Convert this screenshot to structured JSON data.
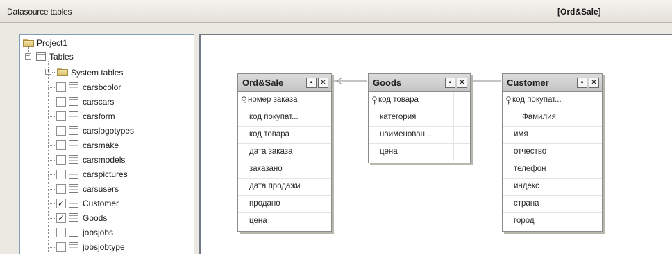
{
  "header": {
    "title": "Datasource tables",
    "context": "[Ord&Sale]"
  },
  "tree": {
    "root": "Project1",
    "tables_node": "Tables",
    "system_tables": "System tables",
    "items": [
      {
        "label": "carsbcolor",
        "checked": false
      },
      {
        "label": "carscars",
        "checked": false
      },
      {
        "label": "carsform",
        "checked": false
      },
      {
        "label": "carslogotypes",
        "checked": false
      },
      {
        "label": "carsmake",
        "checked": false
      },
      {
        "label": "carsmodels",
        "checked": false
      },
      {
        "label": "carspictures",
        "checked": false
      },
      {
        "label": "carsusers",
        "checked": false
      },
      {
        "label": "Customer",
        "checked": true
      },
      {
        "label": "Goods",
        "checked": true
      },
      {
        "label": "jobsjobs",
        "checked": false
      },
      {
        "label": "jobsjobtype",
        "checked": false
      }
    ]
  },
  "entities": {
    "ordsale": {
      "title": "Ord&Sale",
      "fields": [
        "номер заказа",
        "код покупат...",
        "код товара",
        "дата заказа",
        "заказано",
        "дата продажи",
        "продано",
        "цена"
      ]
    },
    "goods": {
      "title": "Goods",
      "fields": [
        "код товара",
        "категория",
        "наименован...",
        "цена"
      ]
    },
    "customer": {
      "title": "Customer",
      "fields": [
        "код покупат...",
        "Фамилия",
        "имя",
        "отчество",
        "телефон",
        "индекс",
        "страна",
        "город"
      ]
    }
  },
  "buttons": {
    "minimize_glyph": "▪",
    "close_glyph": "✕"
  },
  "icons": [
    "folder-icon",
    "table-icon",
    "key-icon",
    "checkbox-icon",
    "expand-icon",
    "collapse-icon",
    "arrow-icon"
  ]
}
